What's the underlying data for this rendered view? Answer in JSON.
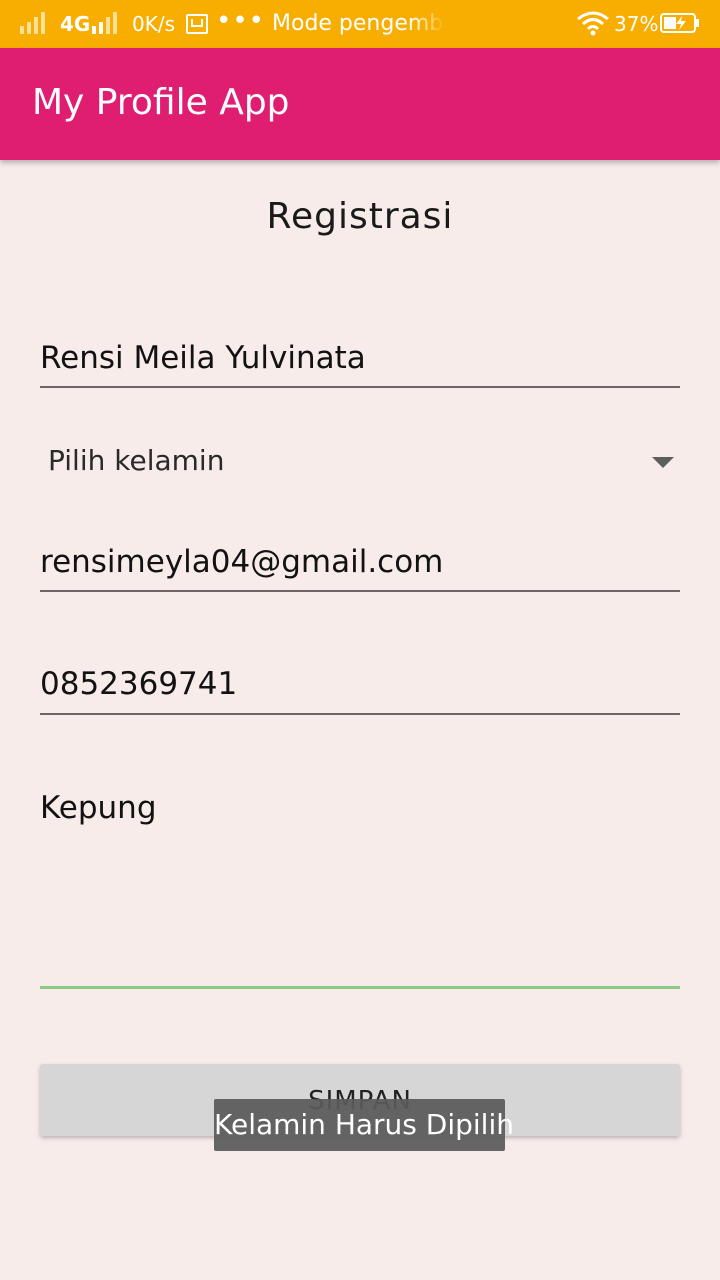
{
  "status_bar": {
    "network": "4G",
    "speed": "0K/s",
    "notification_text": "Mode pengembang",
    "battery_percent": "37%",
    "icons": [
      "signal-icon",
      "signal-icon",
      "mail-icon",
      "more-dots-icon",
      "wifi-icon",
      "battery-charging-icon"
    ],
    "color": "#f8ae00"
  },
  "app_bar": {
    "title": "My Profile App",
    "color": "#e01e71"
  },
  "form": {
    "title": "Registrasi",
    "name_value": "Rensi Meila Yulvinata",
    "gender_spinner_label": "Pilih kelamin",
    "email_value": "rensimeyla04@gmail.com",
    "phone_value": "0852369741",
    "address_value": "Kepung",
    "save_button_label": "SIMPAN"
  },
  "toast": {
    "message": "Kelamin Harus Dipilih"
  },
  "colors": {
    "background": "#f8eceb",
    "focused_underline": "#8cc981",
    "underline": "#6f6363",
    "button": "#d6d6d6"
  }
}
